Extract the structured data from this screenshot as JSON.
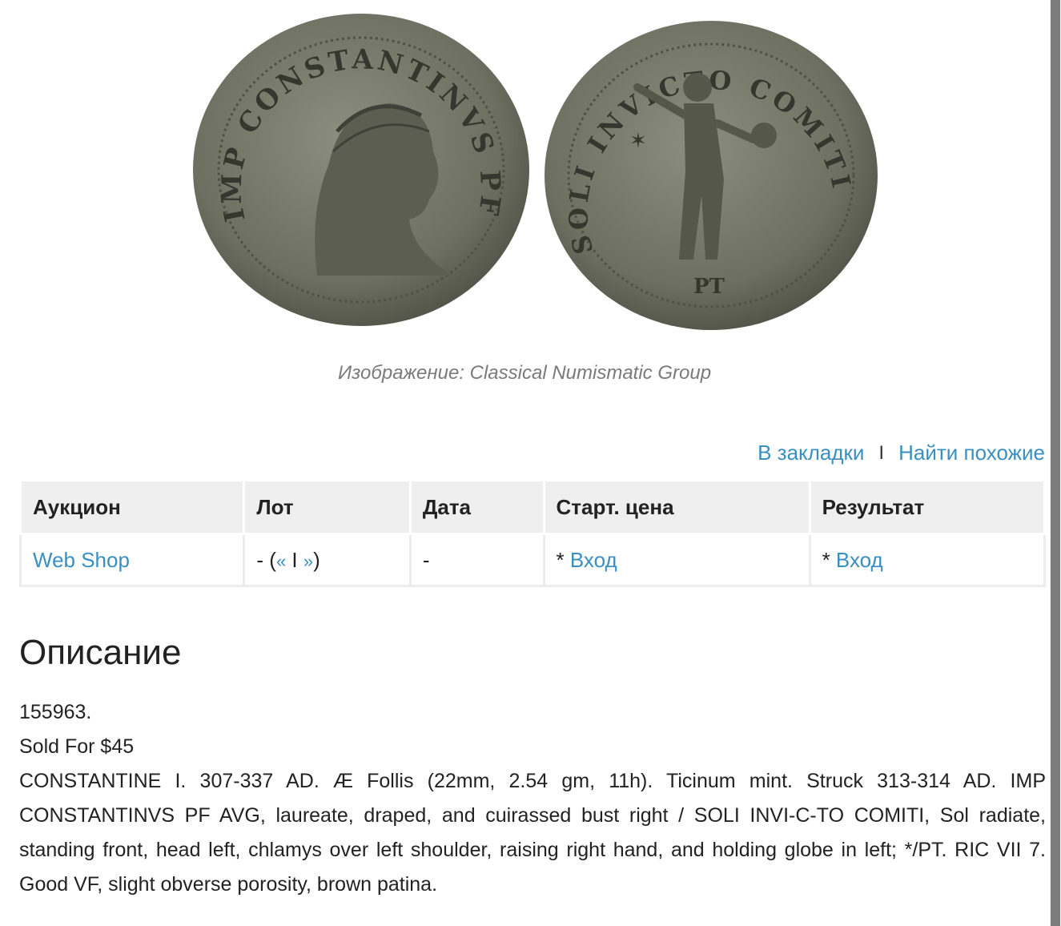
{
  "image": {
    "obverse_legend": "IMP CONSTANTINVS PF AVG",
    "reverse_legend": "SOLI INVICTO COMITI",
    "reverse_mintmark": "PT",
    "caption": "Изображение: Classical Numismatic Group"
  },
  "actions": {
    "bookmark": "В закладки",
    "separator": "I",
    "find_similar": "Найти похожие"
  },
  "table": {
    "headers": [
      "Аукцион",
      "Лот",
      "Дата",
      "Старт. цена",
      "Результат"
    ],
    "row": {
      "auction": "Web Shop",
      "lot_prefix": "- (",
      "lot_prev": "«",
      "lot_sep": " I ",
      "lot_next": "»",
      "lot_suffix": ")",
      "date": "-",
      "start_star": "* ",
      "start_link": "Вход",
      "result_star": "* ",
      "result_link": "Вход"
    }
  },
  "description": {
    "title": "Описание",
    "lot_number": "155963.",
    "sold": "Sold For $45",
    "text": "CONSTANTINE I. 307-337 AD. Æ Follis (22mm, 2.54 gm, 11h). Ticinum mint. Struck 313-314 AD. IMP CONSTANTINVS PF AVG, laureate, draped, and cuirassed bust right / SOLI INVI-C-TO COMITI, Sol radiate, standing front, head left, chlamys over left shoulder, raising right hand, and holding globe in left; */PT. RIC VII 7. Good VF, slight obverse porosity, brown patina."
  },
  "colors": {
    "link": "#3a8fc2",
    "header_bg": "#efefef",
    "coin": "#6f7163"
  }
}
